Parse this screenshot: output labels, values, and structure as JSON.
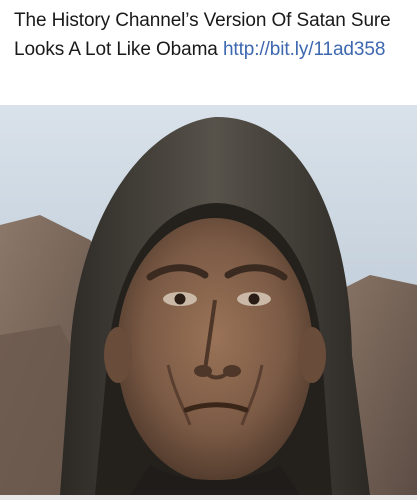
{
  "post": {
    "headline": "The History Channel’s Version Of Satan Sure Looks A Lot Like Obama",
    "link_text": "http://bit.ly/11ad358"
  },
  "media": {
    "subject": "hooded-figure-photo",
    "colors": {
      "sky": "#c3d1de",
      "rock": "#7d6a5d",
      "hood": "#3f3b35",
      "skin": "#7b5a45",
      "background": "#ffffff",
      "link": "#3d68b0"
    }
  }
}
